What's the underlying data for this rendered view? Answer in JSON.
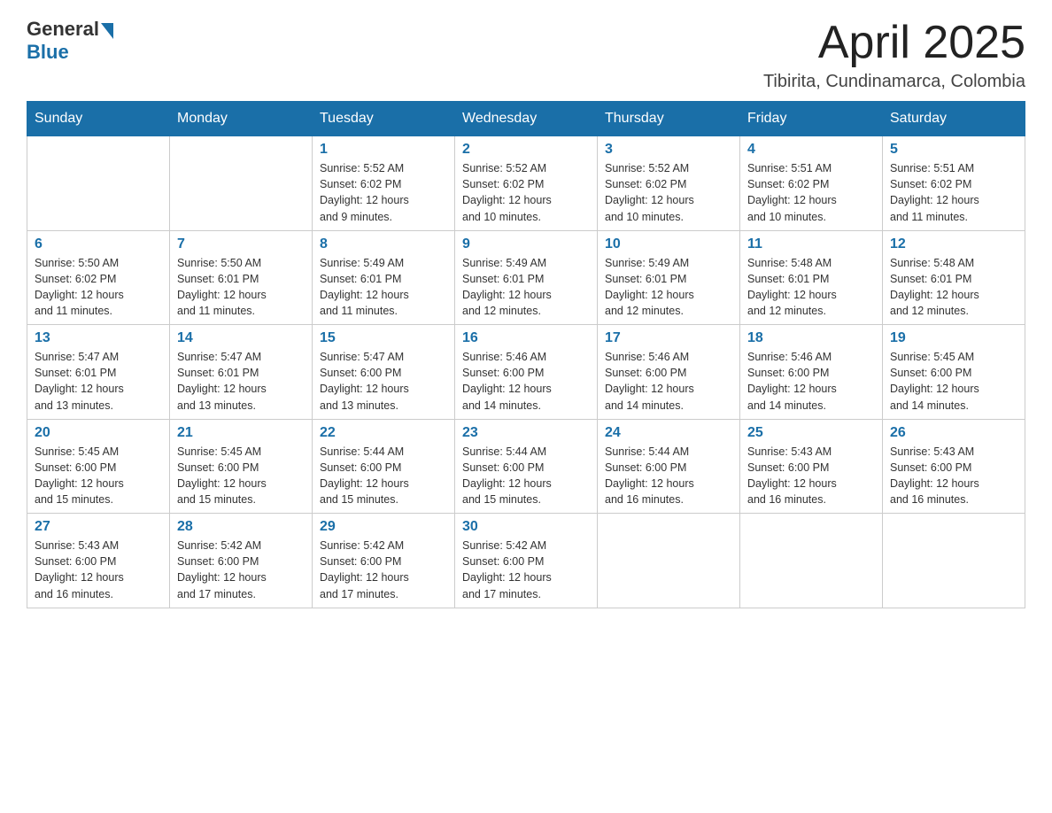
{
  "header": {
    "logo_general": "General",
    "logo_blue": "Blue",
    "title": "April 2025",
    "location": "Tibirita, Cundinamarca, Colombia"
  },
  "weekdays": [
    "Sunday",
    "Monday",
    "Tuesday",
    "Wednesday",
    "Thursday",
    "Friday",
    "Saturday"
  ],
  "weeks": [
    [
      {
        "day": "",
        "info": ""
      },
      {
        "day": "",
        "info": ""
      },
      {
        "day": "1",
        "info": "Sunrise: 5:52 AM\nSunset: 6:02 PM\nDaylight: 12 hours\nand 9 minutes."
      },
      {
        "day": "2",
        "info": "Sunrise: 5:52 AM\nSunset: 6:02 PM\nDaylight: 12 hours\nand 10 minutes."
      },
      {
        "day": "3",
        "info": "Sunrise: 5:52 AM\nSunset: 6:02 PM\nDaylight: 12 hours\nand 10 minutes."
      },
      {
        "day": "4",
        "info": "Sunrise: 5:51 AM\nSunset: 6:02 PM\nDaylight: 12 hours\nand 10 minutes."
      },
      {
        "day": "5",
        "info": "Sunrise: 5:51 AM\nSunset: 6:02 PM\nDaylight: 12 hours\nand 11 minutes."
      }
    ],
    [
      {
        "day": "6",
        "info": "Sunrise: 5:50 AM\nSunset: 6:02 PM\nDaylight: 12 hours\nand 11 minutes."
      },
      {
        "day": "7",
        "info": "Sunrise: 5:50 AM\nSunset: 6:01 PM\nDaylight: 12 hours\nand 11 minutes."
      },
      {
        "day": "8",
        "info": "Sunrise: 5:49 AM\nSunset: 6:01 PM\nDaylight: 12 hours\nand 11 minutes."
      },
      {
        "day": "9",
        "info": "Sunrise: 5:49 AM\nSunset: 6:01 PM\nDaylight: 12 hours\nand 12 minutes."
      },
      {
        "day": "10",
        "info": "Sunrise: 5:49 AM\nSunset: 6:01 PM\nDaylight: 12 hours\nand 12 minutes."
      },
      {
        "day": "11",
        "info": "Sunrise: 5:48 AM\nSunset: 6:01 PM\nDaylight: 12 hours\nand 12 minutes."
      },
      {
        "day": "12",
        "info": "Sunrise: 5:48 AM\nSunset: 6:01 PM\nDaylight: 12 hours\nand 12 minutes."
      }
    ],
    [
      {
        "day": "13",
        "info": "Sunrise: 5:47 AM\nSunset: 6:01 PM\nDaylight: 12 hours\nand 13 minutes."
      },
      {
        "day": "14",
        "info": "Sunrise: 5:47 AM\nSunset: 6:01 PM\nDaylight: 12 hours\nand 13 minutes."
      },
      {
        "day": "15",
        "info": "Sunrise: 5:47 AM\nSunset: 6:00 PM\nDaylight: 12 hours\nand 13 minutes."
      },
      {
        "day": "16",
        "info": "Sunrise: 5:46 AM\nSunset: 6:00 PM\nDaylight: 12 hours\nand 14 minutes."
      },
      {
        "day": "17",
        "info": "Sunrise: 5:46 AM\nSunset: 6:00 PM\nDaylight: 12 hours\nand 14 minutes."
      },
      {
        "day": "18",
        "info": "Sunrise: 5:46 AM\nSunset: 6:00 PM\nDaylight: 12 hours\nand 14 minutes."
      },
      {
        "day": "19",
        "info": "Sunrise: 5:45 AM\nSunset: 6:00 PM\nDaylight: 12 hours\nand 14 minutes."
      }
    ],
    [
      {
        "day": "20",
        "info": "Sunrise: 5:45 AM\nSunset: 6:00 PM\nDaylight: 12 hours\nand 15 minutes."
      },
      {
        "day": "21",
        "info": "Sunrise: 5:45 AM\nSunset: 6:00 PM\nDaylight: 12 hours\nand 15 minutes."
      },
      {
        "day": "22",
        "info": "Sunrise: 5:44 AM\nSunset: 6:00 PM\nDaylight: 12 hours\nand 15 minutes."
      },
      {
        "day": "23",
        "info": "Sunrise: 5:44 AM\nSunset: 6:00 PM\nDaylight: 12 hours\nand 15 minutes."
      },
      {
        "day": "24",
        "info": "Sunrise: 5:44 AM\nSunset: 6:00 PM\nDaylight: 12 hours\nand 16 minutes."
      },
      {
        "day": "25",
        "info": "Sunrise: 5:43 AM\nSunset: 6:00 PM\nDaylight: 12 hours\nand 16 minutes."
      },
      {
        "day": "26",
        "info": "Sunrise: 5:43 AM\nSunset: 6:00 PM\nDaylight: 12 hours\nand 16 minutes."
      }
    ],
    [
      {
        "day": "27",
        "info": "Sunrise: 5:43 AM\nSunset: 6:00 PM\nDaylight: 12 hours\nand 16 minutes."
      },
      {
        "day": "28",
        "info": "Sunrise: 5:42 AM\nSunset: 6:00 PM\nDaylight: 12 hours\nand 17 minutes."
      },
      {
        "day": "29",
        "info": "Sunrise: 5:42 AM\nSunset: 6:00 PM\nDaylight: 12 hours\nand 17 minutes."
      },
      {
        "day": "30",
        "info": "Sunrise: 5:42 AM\nSunset: 6:00 PM\nDaylight: 12 hours\nand 17 minutes."
      },
      {
        "day": "",
        "info": ""
      },
      {
        "day": "",
        "info": ""
      },
      {
        "day": "",
        "info": ""
      }
    ]
  ]
}
